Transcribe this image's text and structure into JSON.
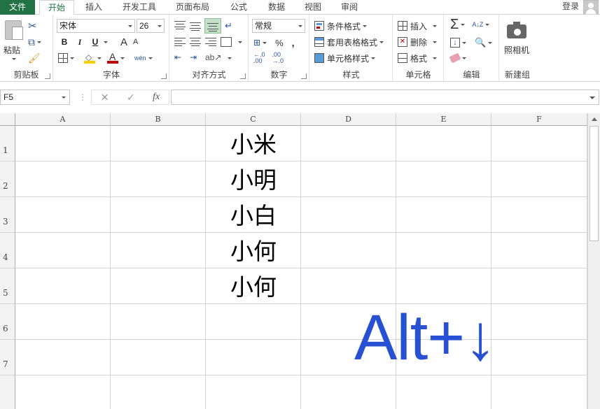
{
  "tabs": {
    "file": "文件",
    "home": "开始",
    "insert": "插入",
    "developer": "开发工具",
    "layout": "页面布局",
    "formulas": "公式",
    "data": "数据",
    "view": "视图",
    "review": "审阅"
  },
  "account": {
    "login": "登录"
  },
  "ribbon": {
    "clipboard": {
      "label": "剪贴板",
      "paste": "粘贴"
    },
    "font": {
      "label": "字体",
      "font_name": "宋体",
      "font_size": "26",
      "bold": "B",
      "italic": "I",
      "underline": "U",
      "grow": "A",
      "shrink": "A",
      "font_color": "A",
      "phonetic": "wén"
    },
    "alignment": {
      "label": "对齐方式"
    },
    "number": {
      "label": "数字",
      "format": "常规",
      "percent": "%",
      "comma": ","
    },
    "styles": {
      "label": "样式",
      "conditional": "条件格式",
      "table": "套用表格格式",
      "cell_styles": "单元格样式"
    },
    "cells": {
      "label": "单元格",
      "insert": "插入",
      "delete": "删除",
      "format": "格式"
    },
    "editing": {
      "label": "编辑",
      "sum": "Σ",
      "sort": "A↓Z"
    },
    "camera": {
      "label": "新建组",
      "button": "照相机"
    }
  },
  "formula_bar": {
    "name_box": "F5",
    "cancel": "✕",
    "enter": "✓",
    "fx": "fx",
    "value": ""
  },
  "sheet": {
    "columns": [
      "A",
      "B",
      "C",
      "D",
      "E",
      "F"
    ],
    "rows": [
      "1",
      "2",
      "3",
      "4",
      "5",
      "6",
      "7"
    ],
    "cells": {
      "C1": "小米",
      "C2": "小明",
      "C3": "小白",
      "C4": "小何",
      "C5": "小何"
    }
  },
  "overlay_text": "Alt+↓",
  "colors": {
    "accent": "#217346",
    "overlay": "#2850d2"
  }
}
